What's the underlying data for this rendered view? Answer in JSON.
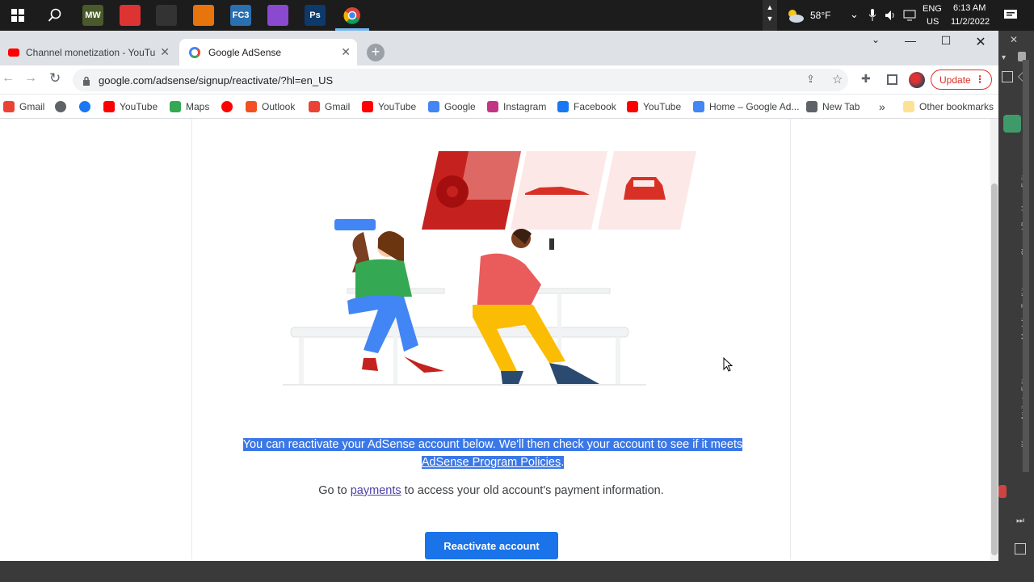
{
  "taskbar": {
    "apps": [
      {
        "name": "mw",
        "label": "MW",
        "color": "#4a5a2a"
      },
      {
        "name": "paint",
        "label": "",
        "color": "#d33"
      },
      {
        "name": "terminal",
        "label": "",
        "color": "#333"
      },
      {
        "name": "blender",
        "label": "",
        "color": "#e8740c"
      },
      {
        "name": "fc3",
        "label": "FC3",
        "color": "#2a6fb0"
      },
      {
        "name": "colorapp",
        "label": "",
        "color": "#8a4ad0"
      },
      {
        "name": "photoshop",
        "label": "Ps",
        "color": "#0d3a6b"
      },
      {
        "name": "chrome",
        "label": "",
        "color": "#3c3c3c"
      }
    ],
    "weather": "58°F",
    "language_line1": "ENG",
    "language_line2": "US",
    "time": "6:13 AM",
    "date": "11/2/2022"
  },
  "browser": {
    "tabs": [
      {
        "title": "Channel monetization - YouTube",
        "active": false
      },
      {
        "title": "Google AdSense",
        "active": true
      }
    ],
    "url": "google.com/adsense/signup/reactivate/?hl=en_US",
    "update_label": "Update",
    "bookmarks": [
      {
        "label": "Gmail",
        "color": "#ea4335"
      },
      {
        "label": "",
        "color": "#5f6368"
      },
      {
        "label": "",
        "color": "#1877f2"
      },
      {
        "label": "YouTube",
        "color": "#ff0000"
      },
      {
        "label": "Maps",
        "color": "#34a853"
      },
      {
        "label": "",
        "color": "#ff0000"
      },
      {
        "label": "Outlook",
        "color": "#f25022"
      },
      {
        "label": "Gmail",
        "color": "#ea4335"
      },
      {
        "label": "YouTube",
        "color": "#ff0000"
      },
      {
        "label": "Google",
        "color": "#4285f4"
      },
      {
        "label": "Instagram",
        "color": "#c13584"
      },
      {
        "label": "Facebook",
        "color": "#1877f2"
      },
      {
        "label": "YouTube",
        "color": "#ff0000"
      },
      {
        "label": "Home – Google Ad...",
        "color": "#4285f4"
      },
      {
        "label": "New Tab",
        "color": "#5f6368"
      }
    ],
    "more_bookmarks": "»",
    "other_bookmarks": "Other bookmarks"
  },
  "page": {
    "message_highlighted": "You can reactivate your AdSense account below. We'll then check your account to see if it meets",
    "policies_link": "AdSense Program Policies",
    "policies_suffix": ".",
    "goto_prefix": "Go to ",
    "payments_link": "payments",
    "goto_suffix": " to access your old account's payment information.",
    "reactivate_button": "Reactivate account"
  },
  "side_panel": {
    "labels": [
      "Channel Box / Layer Editor",
      "Modeling Toolkit",
      "Attribute Editor",
      "an IK"
    ]
  }
}
